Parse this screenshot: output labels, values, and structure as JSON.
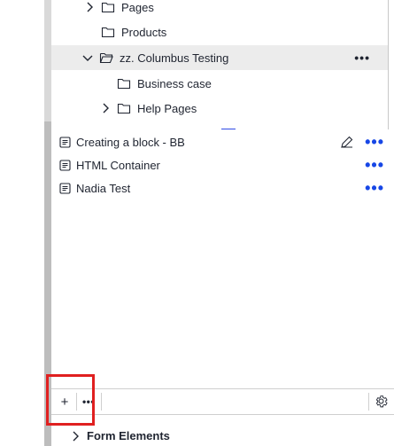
{
  "tree": {
    "items": [
      {
        "label": "Pages",
        "expanded": false
      },
      {
        "label": "Products"
      },
      {
        "label": "zz. Columbus Testing",
        "expanded": true,
        "more_label": "•••"
      },
      {
        "label": "Business case"
      },
      {
        "label": "Help Pages",
        "expanded": false
      }
    ]
  },
  "list": {
    "items": [
      {
        "label": "Creating a block - BB",
        "more_label": "•••"
      },
      {
        "label": "HTML Container",
        "more_label": "•••"
      },
      {
        "label": "Nadia Test",
        "more_label": "•••"
      }
    ]
  },
  "toolbar": {
    "add_label": "+",
    "more_label": "•••"
  },
  "section": {
    "form_elements_label": "Form Elements"
  },
  "colors": {
    "accent": "#1747e6",
    "highlight": "#e02020",
    "selected_bg": "#ececec"
  },
  "icons": {
    "chevron_right": "chevron-right-icon",
    "chevron_down": "chevron-down-icon",
    "folder": "folder-icon",
    "document": "document-icon",
    "pencil": "pencil-icon",
    "gear": "gear-icon"
  }
}
